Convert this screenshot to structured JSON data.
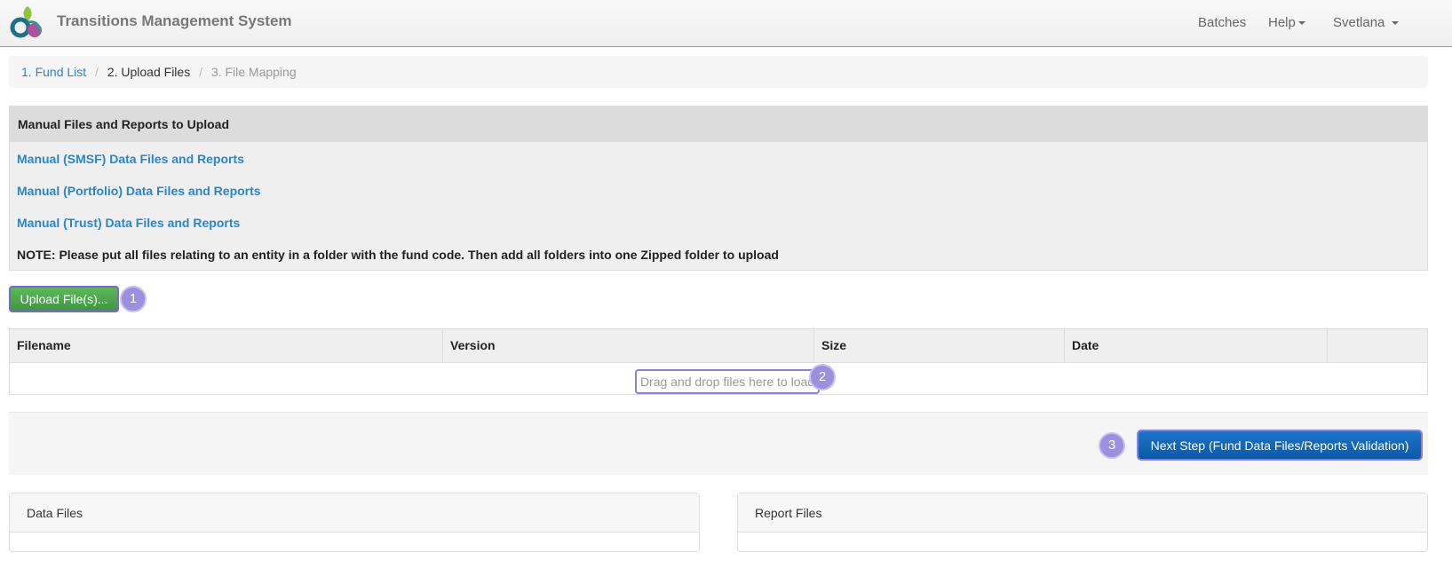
{
  "app": {
    "title": "Transitions Management System"
  },
  "nav": {
    "batches": "Batches",
    "help": "Help",
    "user": "Svetlana"
  },
  "breadcrumb": {
    "step1": "1. Fund List",
    "sep": "/",
    "step2": "2. Upload Files",
    "step3": "3. File Mapping"
  },
  "manual_panel": {
    "header": "Manual Files and Reports to Upload",
    "links": [
      "Manual (SMSF) Data Files and Reports",
      "Manual (Portfolio) Data Files and Reports",
      "Manual (Trust) Data Files and Reports"
    ],
    "note_label": "NOTE",
    "note_text": ": Please put all files relating to an entity in a folder with the fund code. Then add all folders into one Zipped folder to upload"
  },
  "upload": {
    "button_label": "Upload File(s)..."
  },
  "badges": [
    "1",
    "2",
    "3"
  ],
  "file_table": {
    "columns": [
      "Filename",
      "Version",
      "Size",
      "Date",
      ""
    ],
    "dropzone_text": "Drag and drop files here to load"
  },
  "next_step": {
    "button_label": "Next Step (Fund Data Files/Reports Validation)"
  },
  "sections": {
    "data_files": "Data Files",
    "report_files": "Report Files"
  },
  "colors": {
    "link": "#2a86c9",
    "success": "#5cb85c",
    "primary": "#0a5aa8",
    "annotation": "#9d8fe0"
  }
}
